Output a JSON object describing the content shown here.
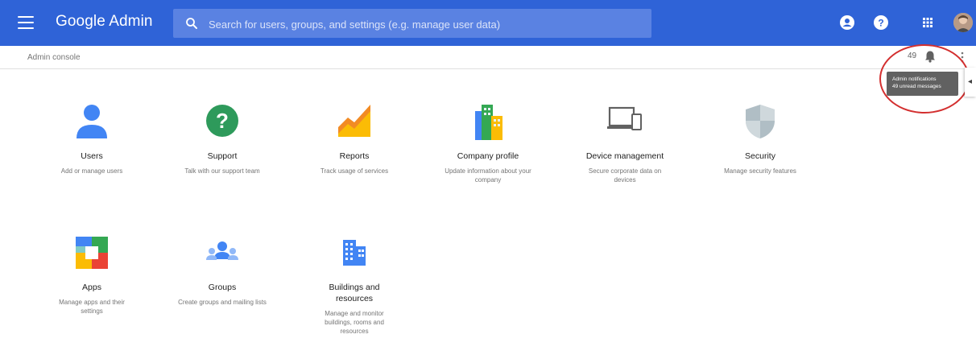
{
  "header": {
    "brand": "Google Admin",
    "search_placeholder": "Search for users, groups, and settings (e.g. manage user data)"
  },
  "subheader": {
    "breadcrumb": "Admin console",
    "notification_count": "49",
    "tooltip_line1": "Admin notifications",
    "tooltip_line2": "49 unread messages"
  },
  "cards": [
    {
      "title": "Users",
      "desc": "Add or manage users",
      "icon": "person-icon"
    },
    {
      "title": "Support",
      "desc": "Talk with our support team",
      "icon": "help-icon"
    },
    {
      "title": "Reports",
      "desc": "Track usage of services",
      "icon": "chart-icon"
    },
    {
      "title": "Company profile",
      "desc": "Update information about your company",
      "icon": "building-icon"
    },
    {
      "title": "Device management",
      "desc": "Secure corporate data on devices",
      "icon": "devices-icon"
    },
    {
      "title": "Security",
      "desc": "Manage security features",
      "icon": "shield-icon"
    },
    {
      "title": "Apps",
      "desc": "Manage apps and their settings",
      "icon": "apps-icon"
    },
    {
      "title": "Groups",
      "desc": "Create groups and mailing lists",
      "icon": "group-icon"
    },
    {
      "title": "Buildings and resources",
      "desc": "Manage and monitor buildings, rooms and resources",
      "icon": "office-building-icon"
    }
  ],
  "colors": {
    "header_bg": "#2f63d7",
    "highlight": "#d32f2f"
  }
}
